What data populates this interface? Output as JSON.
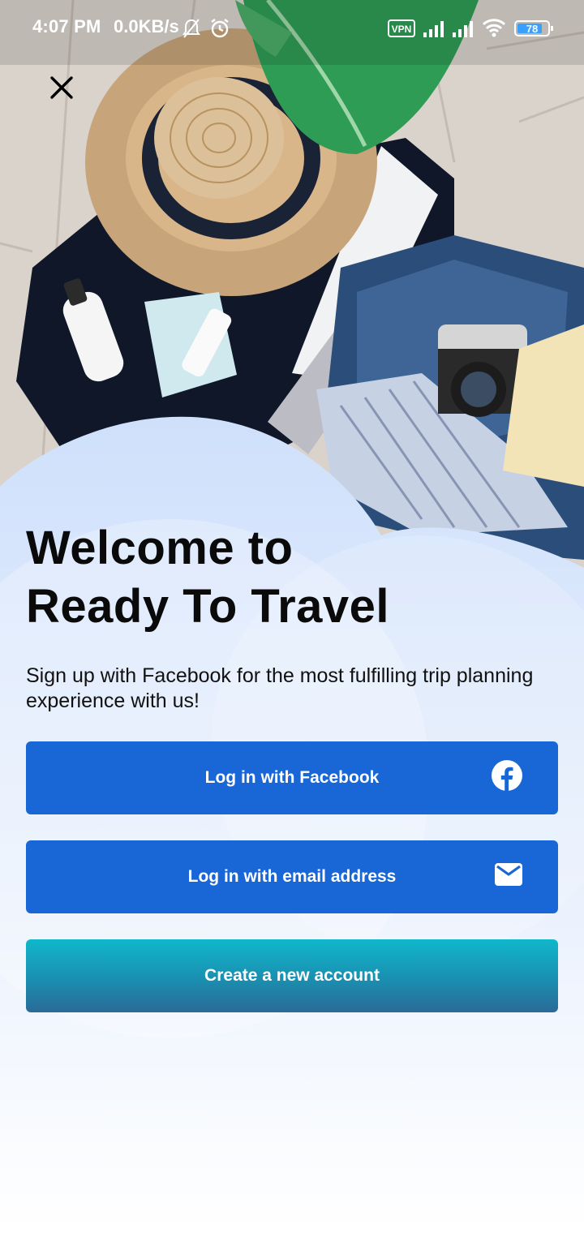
{
  "status_bar": {
    "time": "4:07 PM",
    "net_speed": "0.0KB/s",
    "vpn": "VPN",
    "battery_level": "78",
    "icons": [
      "mute-bell-icon",
      "alarm-icon",
      "vpn-icon",
      "signal-icon",
      "signal-icon",
      "wifi-icon",
      "battery-icon"
    ]
  },
  "header": {
    "close_icon": "close-icon"
  },
  "welcome": {
    "title_line1": "Welcome to",
    "title_line2": "Ready To Travel",
    "subtitle": "Sign up with Facebook for the most fulfilling trip planning experience with us!"
  },
  "actions": {
    "facebook_label": "Log in with Facebook",
    "facebook_icon": "facebook-icon",
    "email_label": "Log in with email address",
    "email_icon": "mail-icon",
    "create_label": "Create a new account"
  },
  "colors": {
    "primary_button": "#1966d6",
    "create_button_top": "#10b7cc",
    "create_button_bottom": "#2a6a98",
    "sheet_tint": "#d8e6fb"
  }
}
